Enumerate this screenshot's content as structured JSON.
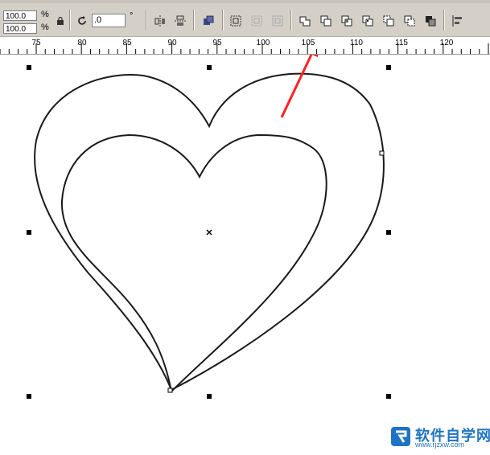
{
  "toolbar": {
    "width_value": "100.0",
    "height_value": "100.0",
    "width_unit": "%",
    "height_unit": "%",
    "rotation_value": ".0",
    "rotation_unit": "°"
  },
  "ruler": {
    "labels": [
      "75",
      "80",
      "85",
      "90",
      "95",
      "100",
      "105",
      "110",
      "115",
      "120"
    ]
  },
  "watermark": {
    "text": "软件自学网",
    "url": "www.rjzxw.com"
  },
  "colors": {
    "toolbar_bg": "#d4d0c8",
    "outline": "#1a1a1a",
    "arrow": "#ff2020",
    "watermark": "#1e74c4"
  }
}
